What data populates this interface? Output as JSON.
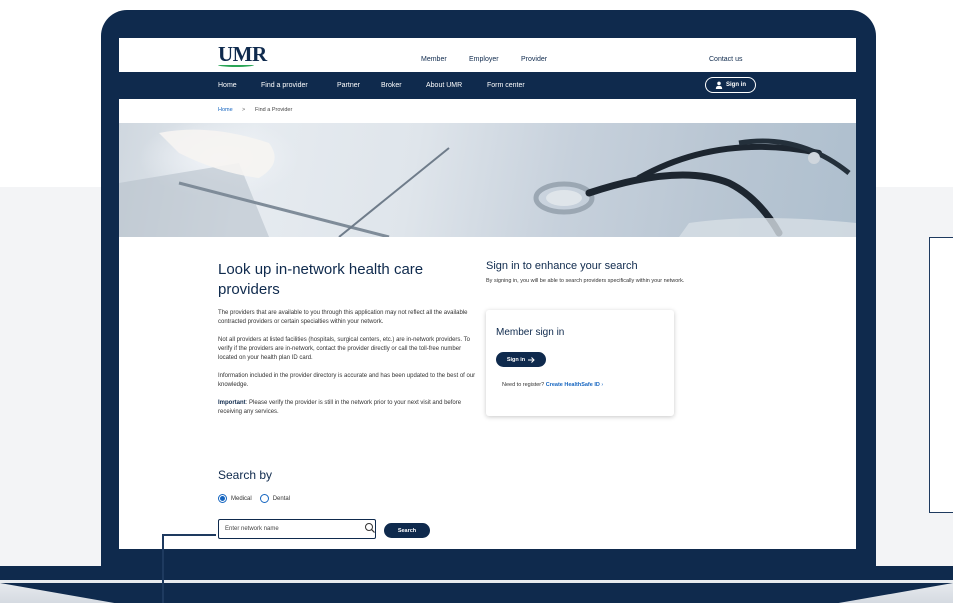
{
  "header": {
    "logo": "UMR",
    "audience_links": [
      "Member",
      "Employer",
      "Provider"
    ],
    "contact": "Contact us"
  },
  "nav": {
    "items": [
      "Home",
      "Find a provider",
      "Partner",
      "Broker",
      "About UMR",
      "Form center"
    ],
    "sign_in": "Sign in"
  },
  "breadcrumb": {
    "home": "Home",
    "separator": ">",
    "current": "Find a Provider"
  },
  "main": {
    "title": "Look up in-network health care providers",
    "paragraphs": [
      "The providers that are available to you through this application may not reflect all the available contracted providers or certain specialties within your network.",
      "Not all providers at listed facilities (hospitals, surgical centers, etc.) are in-network providers. To verify if the providers are in-network, contact the provider directly or call the toll-free number located on your health plan ID card.",
      "Information included in the provider directory is accurate and has been updated to the best of our knowledge."
    ],
    "important_label": "Important",
    "important_text": ": Please verify the provider is still in the network prior to your next visit and before receiving any services."
  },
  "search": {
    "title": "Search by",
    "options": [
      "Medical",
      "Dental"
    ],
    "selected": "Medical",
    "placeholder": "Enter network name",
    "button": "Search"
  },
  "signin_panel": {
    "title": "Sign in to enhance your search",
    "subtitle": "By signing in, you will be able to search providers specifically within your network.",
    "card_title": "Member sign in",
    "card_button": "Sign in",
    "register_text": "Need to register?",
    "register_link": "Create HealthSafe ID"
  },
  "colors": {
    "navy": "#0f2a4d",
    "link_blue": "#1565c0",
    "logo_green": "#2aa556"
  }
}
